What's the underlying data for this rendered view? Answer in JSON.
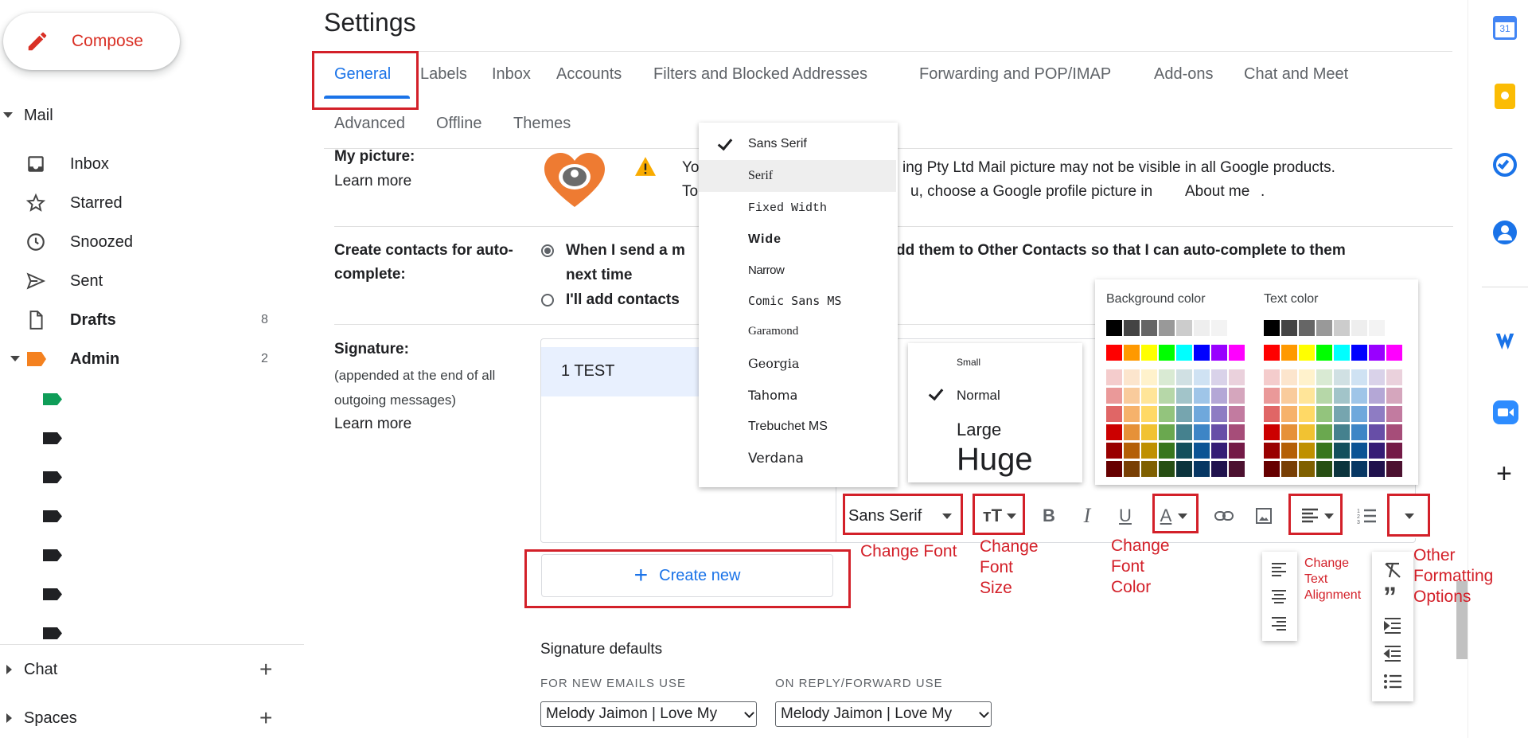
{
  "compose": {
    "label": "Compose"
  },
  "nav": {
    "mail": "Mail",
    "items": [
      {
        "label": "Inbox",
        "count": ""
      },
      {
        "label": "Starred",
        "count": ""
      },
      {
        "label": "Snoozed",
        "count": ""
      },
      {
        "label": "Sent",
        "count": ""
      },
      {
        "label": "Drafts",
        "count": "8"
      },
      {
        "label": "Admin",
        "count": "2"
      }
    ],
    "chat": "Chat",
    "spaces": "Spaces"
  },
  "header": {
    "title": "Settings",
    "tabs": [
      "General",
      "Labels",
      "Inbox",
      "Accounts",
      "Filters and Blocked Addresses",
      "Forwarding and POP/IMAP",
      "Add-ons",
      "Chat and Meet",
      "Advanced",
      "Offline",
      "Themes"
    ]
  },
  "picture": {
    "label": "My picture:",
    "learn_more": "Learn more",
    "line1": "Yo",
    "line1b": "ing Pty Ltd Mail picture may not be visible in all Google products.",
    "line2": "To",
    "line2b": "u, choose a Google profile picture in",
    "about_me": "About me",
    "period": "."
  },
  "contacts": {
    "label": "Create contacts for auto-complete:",
    "opt1a": "When I send a m",
    "opt1b": "dd them to Other Contacts so that I can auto-complete to them",
    "opt1c": "next time",
    "opt2": "I'll add contacts"
  },
  "signature": {
    "label": "Signature:",
    "desc": "(appended at the end of all outgoing messages)",
    "learn_more": "Learn more",
    "item": "1 TEST",
    "create_new": "Create new",
    "defaults_title": "Signature defaults",
    "new_label": "FOR NEW EMAILS USE",
    "reply_label": "ON REPLY/FORWARD USE",
    "new_value": "Melody Jaimon | Love My",
    "reply_value": "Melody Jaimon | Love My"
  },
  "font_menu": {
    "items": [
      "Sans Serif",
      "Serif",
      "Fixed Width",
      "Wide",
      "Narrow",
      "Comic Sans MS",
      "Garamond",
      "Georgia",
      "Tahoma",
      "Trebuchet MS",
      "Verdana"
    ],
    "selected": "Sans Serif",
    "highlighted": "Serif"
  },
  "size_menu": {
    "items": [
      "Small",
      "Normal",
      "Large",
      "Huge"
    ],
    "selected": "Normal"
  },
  "color_menu": {
    "background_label": "Background color",
    "text_label": "Text color",
    "greys": [
      "#000000",
      "#444444",
      "#666666",
      "#999999",
      "#cccccc",
      "#eeeeee",
      "#f3f3f3",
      "#ffffff"
    ],
    "brights": [
      "#ff0000",
      "#ff9900",
      "#ffff00",
      "#00ff00",
      "#00ffff",
      "#0000ff",
      "#9900ff",
      "#ff00ff"
    ],
    "shades": [
      [
        "#f4cccc",
        "#fce5cd",
        "#fff2cc",
        "#d9ead3",
        "#d0e0e3",
        "#cfe2f3",
        "#d9d2e9",
        "#ead1dc"
      ],
      [
        "#ea9999",
        "#f9cb9c",
        "#ffe599",
        "#b6d7a8",
        "#a2c4c9",
        "#9fc5e8",
        "#b4a7d6",
        "#d5a6bd"
      ],
      [
        "#e06666",
        "#f6b26b",
        "#ffd966",
        "#93c47d",
        "#76a5af",
        "#6fa8dc",
        "#8e7cc3",
        "#c27ba0"
      ],
      [
        "#cc0000",
        "#e69138",
        "#f1c232",
        "#6aa84f",
        "#45818e",
        "#3d85c6",
        "#674ea7",
        "#a64d79"
      ],
      [
        "#990000",
        "#b45f06",
        "#bf9000",
        "#38761d",
        "#134f5c",
        "#0b5394",
        "#351c75",
        "#741b47"
      ],
      [
        "#660000",
        "#783f04",
        "#7f6000",
        "#274e13",
        "#0c343d",
        "#073763",
        "#20124d",
        "#4c1130"
      ]
    ]
  },
  "toolbar": {
    "font": "Sans Serif",
    "bold": "B",
    "italic": "I",
    "underline": "U",
    "textcolor": "A"
  },
  "annotations": {
    "change_font": "Change Font",
    "change_font_size": "Change\nFont\nSize",
    "change_font_color": "Change\nFont\nColor",
    "change_text_alignment": "Change\nText\nAlignment",
    "other_formatting": "Other\nFormatting\nOptions"
  },
  "colors": {
    "accent": "#1a73e8",
    "annotation": "#d32029",
    "compose": "#d93025"
  }
}
